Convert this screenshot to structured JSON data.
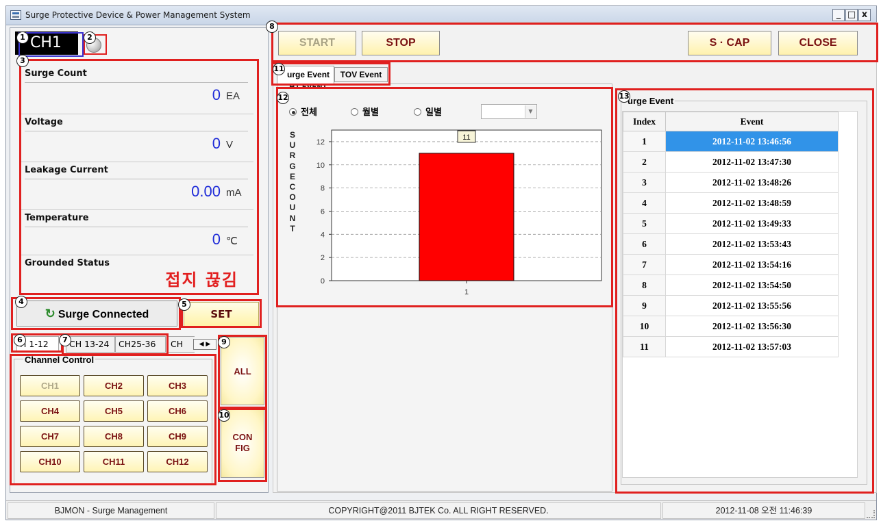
{
  "window": {
    "title": "Surge Protective Device & Power Management System",
    "min": "_",
    "max": "□",
    "close": "x"
  },
  "markers": [
    "1",
    "2",
    "3",
    "4",
    "5",
    "6",
    "7",
    "8",
    "9",
    "10",
    "11",
    "12",
    "13"
  ],
  "channel": {
    "label": "CH1"
  },
  "measurements": [
    {
      "label": "Surge Count",
      "value": "0",
      "unit": "EA"
    },
    {
      "label": "Voltage",
      "value": "0",
      "unit": "V"
    },
    {
      "label": "Leakage Current",
      "value": "0.00",
      "unit": "mA"
    },
    {
      "label": "Temperature",
      "value": "0",
      "unit": "℃"
    }
  ],
  "grounded": {
    "label": "Grounded Status",
    "value": "접지 끊김"
  },
  "connection": {
    "status": "Surge Connected"
  },
  "set_label": "SET",
  "group_tabs": [
    "H 1-12",
    "CH 13-24",
    "CH25-36",
    "CH"
  ],
  "tab_scroll": "◀ ▶",
  "channel_control": {
    "title": "Channel Control",
    "buttons": [
      "CH1",
      "CH2",
      "CH3",
      "CH4",
      "CH5",
      "CH6",
      "CH7",
      "CH8",
      "CH9",
      "CH10",
      "CH11",
      "CH12"
    ]
  },
  "side_buttons": {
    "all": "ALL",
    "config_line1": "CON",
    "config_line2": "FIG"
  },
  "toolbar": {
    "start": "START",
    "stop": "STOP",
    "scap": "S · CAP",
    "close": "CLOSE"
  },
  "tabs": {
    "surge": "urge Event",
    "tov": "TOV Event"
  },
  "event_chart": {
    "title": "H1 EVENT",
    "radio": [
      "전체",
      "월별",
      "일별"
    ],
    "select_value": ""
  },
  "chart_data": {
    "type": "bar",
    "categories": [
      "1"
    ],
    "values": [
      11
    ],
    "data_labels": [
      "11"
    ],
    "ylabel": "SURGE COUNT",
    "ylim": [
      0,
      13
    ],
    "yticks": [
      0,
      2,
      4,
      6,
      8,
      10,
      12
    ],
    "grid": true,
    "bar_color": "#ff0000"
  },
  "event_table": {
    "title": "urge Event",
    "headers": [
      "Index",
      "Event"
    ],
    "rows": [
      {
        "index": "1",
        "event": "2012-11-02 13:46:56"
      },
      {
        "index": "2",
        "event": "2012-11-02 13:47:30"
      },
      {
        "index": "3",
        "event": "2012-11-02 13:48:26"
      },
      {
        "index": "4",
        "event": "2012-11-02 13:48:59"
      },
      {
        "index": "5",
        "event": "2012-11-02 13:49:33"
      },
      {
        "index": "6",
        "event": "2012-11-02 13:53:43"
      },
      {
        "index": "7",
        "event": "2012-11-02 13:54:16"
      },
      {
        "index": "8",
        "event": "2012-11-02 13:54:50"
      },
      {
        "index": "9",
        "event": "2012-11-02 13:55:56"
      },
      {
        "index": "10",
        "event": "2012-11-02 13:56:30"
      },
      {
        "index": "11",
        "event": "2012-11-02 13:57:03"
      }
    ]
  },
  "statusbar": {
    "app": "BJMON - Surge Management",
    "copyright": "COPYRIGHT@2011  BJTEK Co. ALL RIGHT RESERVED.",
    "datetime": "2012-11-08 오전 11:46:39"
  },
  "colors": {
    "highlight": "#e0201f",
    "value_blue": "#1e2bd8",
    "selected_row": "#3193e8"
  }
}
